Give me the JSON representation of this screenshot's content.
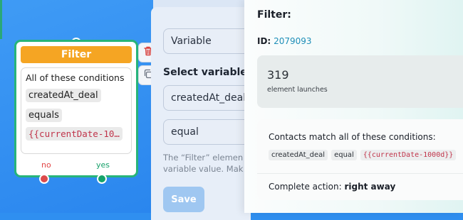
{
  "node": {
    "title": "Filter",
    "conditions_heading": "All of these conditions",
    "variable": "createdAt_deal",
    "operator": "equals",
    "value": "{{currentDate-10…",
    "output_no": "no",
    "output_yes": "yes"
  },
  "settings": {
    "type_field": "Variable",
    "select_variable_label": "Select variable",
    "variable_field": "createdAt_deal",
    "operator_field": "equal",
    "hint_line1": "The “Filter” elemen",
    "hint_line2": "variable value. Mak",
    "save_label": "Save"
  },
  "stats": {
    "title": "Filter:",
    "id_label": "ID:",
    "id_value": "2079093",
    "launch_count": "319",
    "launch_label": "element launches",
    "conditions_heading": "Contacts match all of these conditions:",
    "chips": [
      "createdAt_deal",
      "equal",
      "{{currentDate-1000d}}"
    ],
    "action_label": "Complete action:",
    "action_value": "right away"
  },
  "colors": {
    "canvas": "#2f8ff0",
    "node_border": "#27b47a",
    "node_header": "#f5a523",
    "no": "#dc4b4b",
    "yes": "#15a36a",
    "id_link": "#1f8fb8"
  },
  "icons": {
    "delete": "trash-icon",
    "copy": "copy-icon"
  }
}
